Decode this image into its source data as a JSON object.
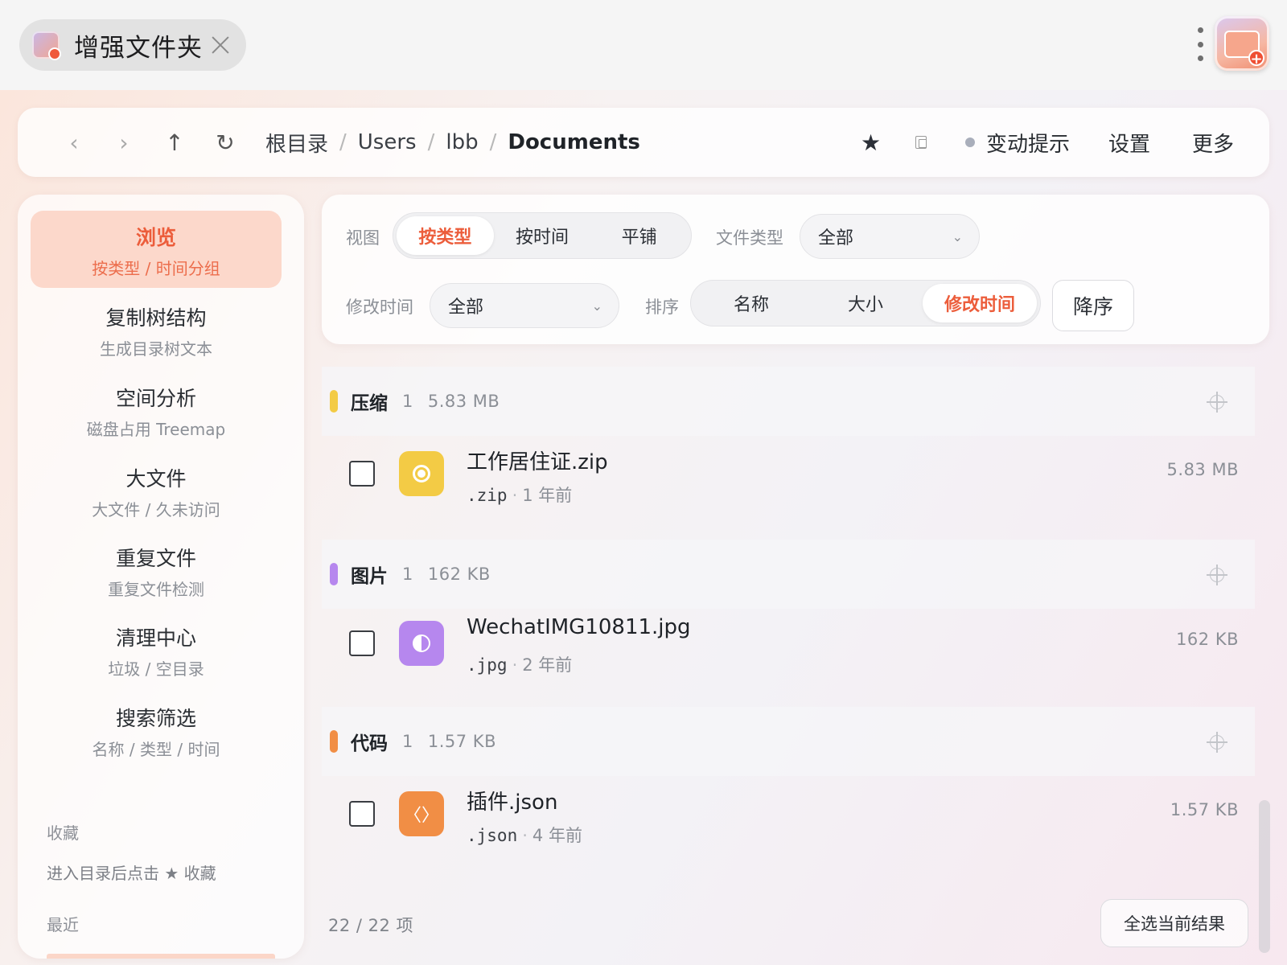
{
  "tab": {
    "title": "增强文件夹"
  },
  "toolbar": {
    "back_icon": "‹",
    "forward_icon": "›",
    "up_icon": "↑",
    "refresh_icon": "↻",
    "breadcrumbs": [
      "根目录",
      "Users",
      "lbb",
      "Documents"
    ],
    "separator": "/",
    "favorite_icon": "★",
    "change_hint": "变动提示",
    "settings": "设置",
    "more": "更多"
  },
  "sidebar": {
    "items": [
      {
        "title": "浏览",
        "subtitle": "按类型 / 时间分组",
        "active": true
      },
      {
        "title": "复制树结构",
        "subtitle": "生成目录树文本"
      },
      {
        "title": "空间分析",
        "subtitle": "磁盘占用 Treemap"
      },
      {
        "title": "大文件",
        "subtitle": "大文件 / 久未访问"
      },
      {
        "title": "重复文件",
        "subtitle": "重复文件检测"
      },
      {
        "title": "清理中心",
        "subtitle": "垃圾 / 空目录"
      },
      {
        "title": "搜索筛选",
        "subtitle": "名称 / 类型 / 时间"
      }
    ],
    "favorites_label": "收藏",
    "favorites_hint": "进入目录后点击 ★ 收藏",
    "recent_label": "最近"
  },
  "filters": {
    "view_label": "视图",
    "view_options": [
      "按类型",
      "按时间",
      "平铺"
    ],
    "view_selected": "按类型",
    "filetype_label": "文件类型",
    "filetype_value": "全部",
    "mtime_label": "修改时间",
    "mtime_value": "全部",
    "sort_label": "排序",
    "sort_options": [
      "名称",
      "大小",
      "修改时间"
    ],
    "sort_selected": "修改时间",
    "order_button": "降序",
    "chevron": "⌄"
  },
  "groups": [
    {
      "name": "压缩",
      "count": "1",
      "size": "5.83 MB",
      "color": "#f3cb45",
      "files": [
        {
          "name": "工作居住证.zip",
          "ext": ".zip",
          "age": "1 年前",
          "size": "5.83 MB",
          "icon": "archive-icon"
        }
      ]
    },
    {
      "name": "图片",
      "count": "1",
      "size": "162 KB",
      "color": "#b687ee",
      "files": [
        {
          "name": "WechatIMG10811.jpg",
          "ext": ".jpg",
          "age": "2 年前",
          "size": "162 KB",
          "icon": "image-icon"
        }
      ]
    },
    {
      "name": "代码",
      "count": "1",
      "size": "1.57 KB",
      "color": "#f18e45",
      "files": [
        {
          "name": "插件.json",
          "ext": ".json",
          "age": "4 年前",
          "size": "1.57 KB",
          "icon": "code-icon"
        }
      ]
    }
  ],
  "footer": {
    "count": "22 / 22 项",
    "select_all": "全选当前结果"
  },
  "code_glyph": "〈〉",
  "dot_separator": "·"
}
